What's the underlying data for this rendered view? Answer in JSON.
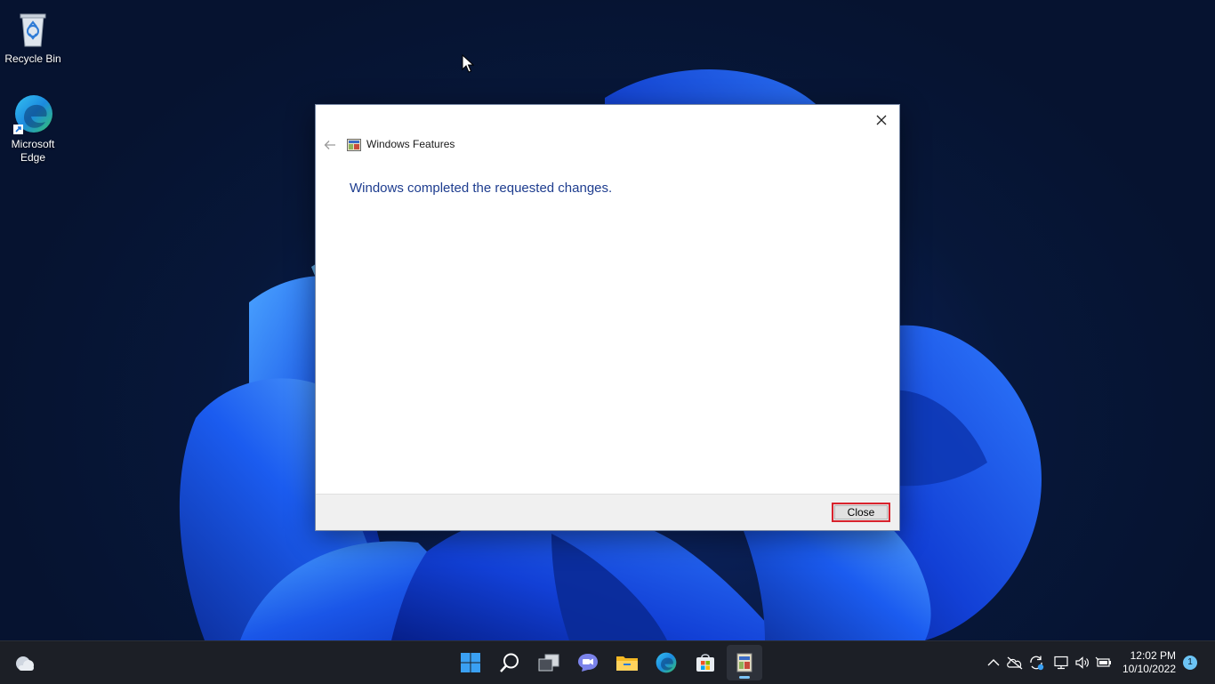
{
  "desktop": {
    "icons": [
      {
        "label": "Recycle Bin",
        "icon": "recycle-bin-icon"
      },
      {
        "label": "Microsoft Edge",
        "icon": "edge-icon"
      }
    ]
  },
  "dialog": {
    "title": "Windows Features",
    "message": "Windows completed the requested changes.",
    "close_button": "Close",
    "accent_color": "#1e3d8f",
    "highlight_color": "#d9232d"
  },
  "taskbar": {
    "apps": [
      {
        "name": "weather",
        "icon": "weather-icon"
      },
      {
        "name": "start",
        "icon": "windows-start-icon"
      },
      {
        "name": "search",
        "icon": "search-icon"
      },
      {
        "name": "task-view",
        "icon": "task-view-icon"
      },
      {
        "name": "chat",
        "icon": "chat-icon"
      },
      {
        "name": "file-explorer",
        "icon": "folder-icon"
      },
      {
        "name": "edge",
        "icon": "edge-icon"
      },
      {
        "name": "store",
        "icon": "store-icon"
      },
      {
        "name": "windows-features",
        "icon": "windows-features-icon",
        "active": true
      }
    ],
    "tray": [
      "chevron-up-icon",
      "cloud-offline-icon",
      "sync-icon",
      "network-icon",
      "volume-icon",
      "battery-icon"
    ],
    "time": "12:02 PM",
    "date": "10/10/2022",
    "notification_count": "1"
  }
}
